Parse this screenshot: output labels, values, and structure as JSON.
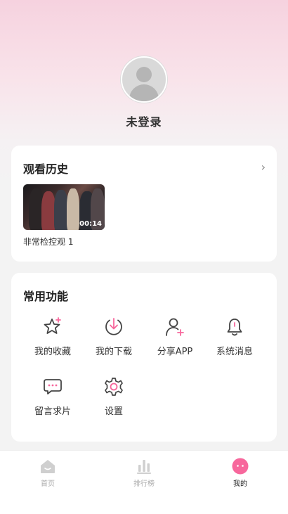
{
  "profile": {
    "login_status": "未登录"
  },
  "history": {
    "title": "观看历史",
    "chevron": "›",
    "items": [
      {
        "title": "非常检控观 1",
        "duration": "00:14"
      }
    ]
  },
  "functions": {
    "title": "常用功能",
    "items": [
      {
        "label": "我的收藏",
        "icon": "star-plus-icon"
      },
      {
        "label": "我的下载",
        "icon": "download-icon"
      },
      {
        "label": "分享APP",
        "icon": "user-plus-icon"
      },
      {
        "label": "系统消息",
        "icon": "bell-icon"
      },
      {
        "label": "留言求片",
        "icon": "chat-bubble-icon"
      },
      {
        "label": "设置",
        "icon": "gear-icon"
      }
    ]
  },
  "tabbar": {
    "tabs": [
      {
        "label": "首页",
        "icon": "home-icon",
        "active": false
      },
      {
        "label": "排行榜",
        "icon": "ranking-icon",
        "active": false
      },
      {
        "label": "我的",
        "icon": "profile-face-icon",
        "active": true
      }
    ]
  },
  "colors": {
    "accent": "#f7679c",
    "icon_dark": "#444444",
    "inactive": "#c8c8c8"
  }
}
